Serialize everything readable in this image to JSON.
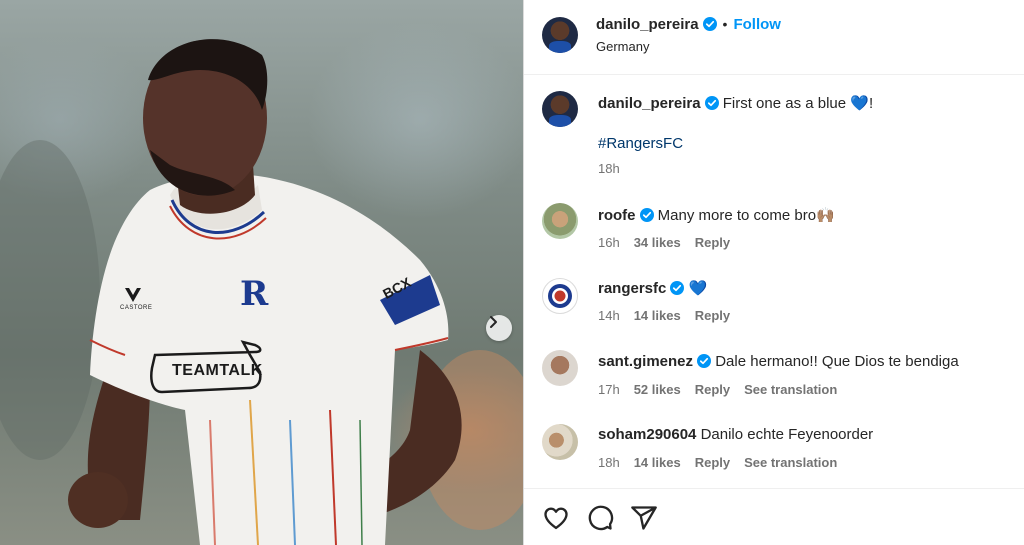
{
  "post": {
    "author": "danilo_pereira",
    "follow_label": "Follow",
    "separator": "•",
    "location": "Germany",
    "caption": {
      "username": "danilo_pereira",
      "text": "First one as a blue 💙!",
      "hashtag": "#RangersFC",
      "time": "18h"
    }
  },
  "comments": [
    {
      "username": "roofe",
      "verified": true,
      "text": "Many more to come bro🙌🏽",
      "time": "16h",
      "likes": "34 likes",
      "reply": "Reply",
      "translation": ""
    },
    {
      "username": "rangersfc",
      "verified": true,
      "text": "💙",
      "time": "14h",
      "likes": "14 likes",
      "reply": "Reply",
      "translation": ""
    },
    {
      "username": "sant.gimenez",
      "verified": true,
      "text": "Dale hermano!! Que Dios te bendiga",
      "time": "17h",
      "likes": "52 likes",
      "reply": "Reply",
      "translation": "See translation"
    },
    {
      "username": "soham290604",
      "verified": false,
      "text": "Danilo echte Feyenoorder",
      "time": "18h",
      "likes": "14 likes",
      "reply": "Reply",
      "translation": "See translation"
    }
  ],
  "photo": {
    "shirt_sponsor": "TEAMTALK",
    "sleeve_sponsor": "BCX",
    "kit_brand": "CASTORE"
  },
  "icons": {
    "like": "heart-icon",
    "comment": "comment-icon",
    "share": "send-icon",
    "next": "chevron-right-icon",
    "verified": "verified-badge-icon"
  },
  "colors": {
    "accent": "#0095f6",
    "verified": "#0095f6",
    "hashtag": "#00376b",
    "muted": "#737373",
    "shirt": "#f2f1ee"
  }
}
